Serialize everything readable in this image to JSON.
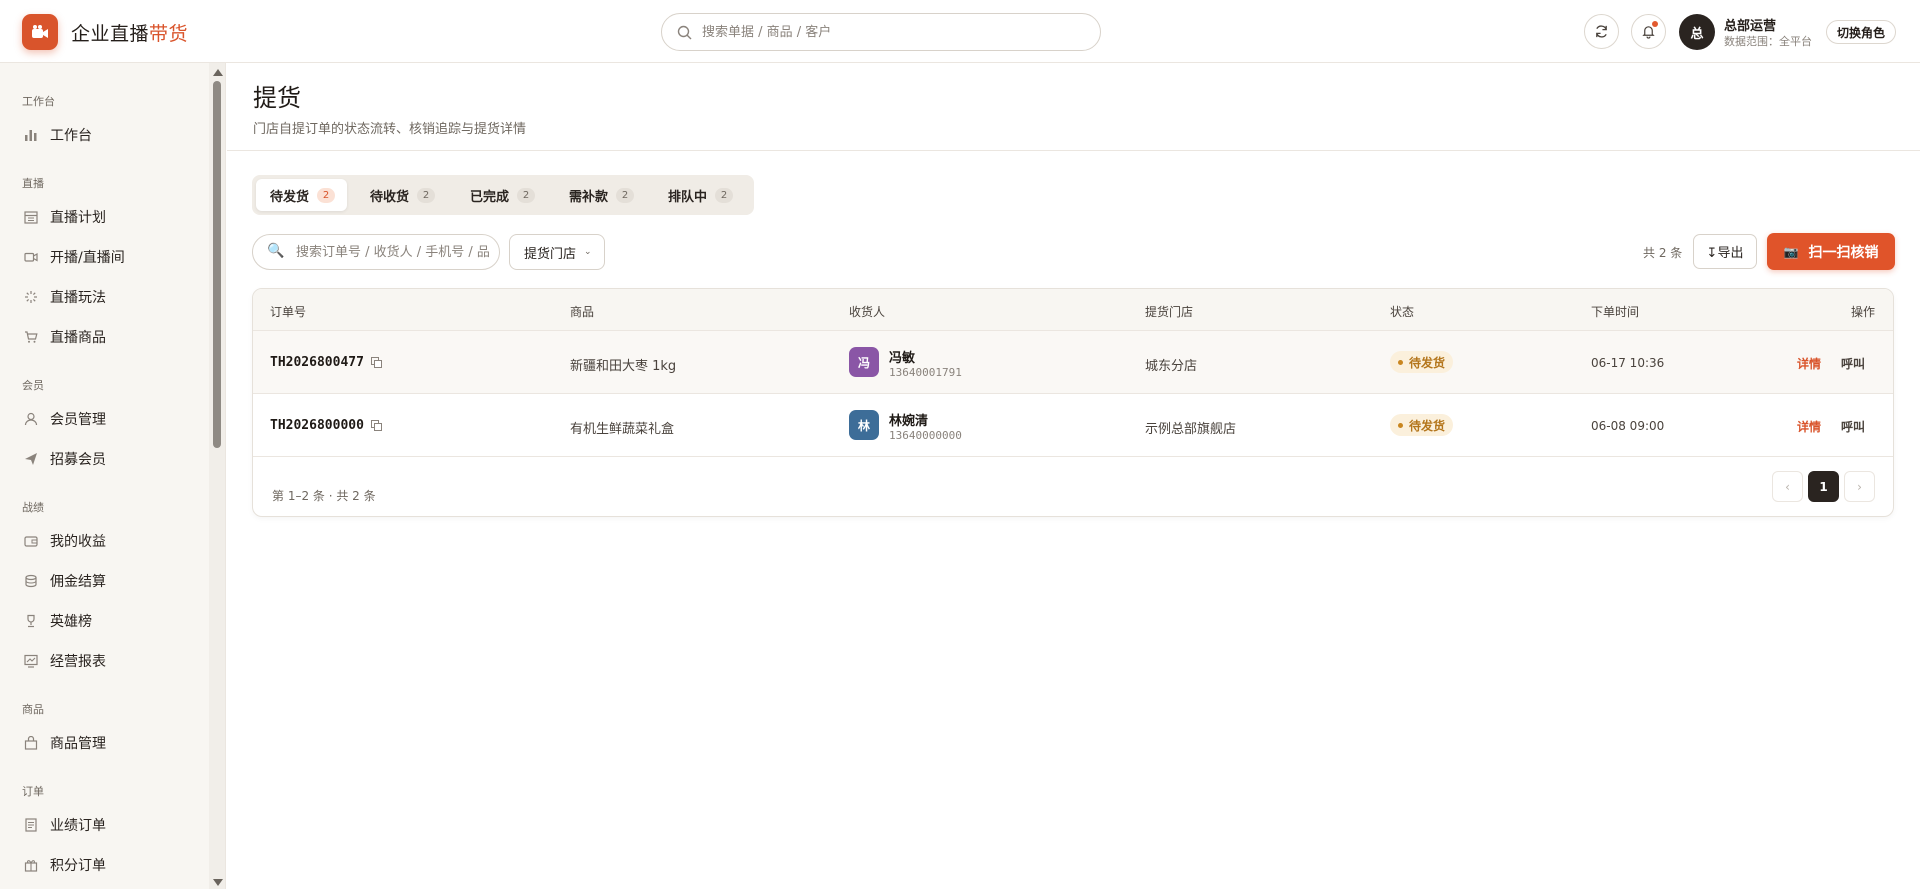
{
  "brand": {
    "name": "企业直播",
    "accent": "带货",
    "logo_icon": "camera-icon",
    "accent_color": "#d9542b"
  },
  "header": {
    "search_placeholder": "搜索单据 / 商品 / 客户",
    "refresh_icon": "refresh-icon",
    "bell_icon": "bell-icon",
    "avatar_text": "总",
    "user_name": "总部运营",
    "user_scope": "数据范围：全平台",
    "switch_role_label": "切换角色"
  },
  "sidebar": {
    "groups": [
      {
        "title": "工作台",
        "items": [
          {
            "label": "工作台",
            "icon": "bar-chart-icon"
          }
        ]
      },
      {
        "title": "直播",
        "items": [
          {
            "label": "直播计划",
            "icon": "calendar-icon"
          },
          {
            "label": "开播/直播间",
            "icon": "video-icon"
          },
          {
            "label": "直播玩法",
            "icon": "sparkle-icon"
          },
          {
            "label": "直播商品",
            "icon": "cart-icon"
          }
        ]
      },
      {
        "title": "会员",
        "items": [
          {
            "label": "会员管理",
            "icon": "user-icon"
          },
          {
            "label": "招募会员",
            "icon": "send-icon"
          }
        ]
      },
      {
        "title": "战绩",
        "items": [
          {
            "label": "我的收益",
            "icon": "wallet-icon"
          },
          {
            "label": "佣金结算",
            "icon": "coins-icon"
          },
          {
            "label": "英雄榜",
            "icon": "trophy-icon"
          },
          {
            "label": "经营报表",
            "icon": "report-icon"
          }
        ]
      },
      {
        "title": "商品",
        "items": [
          {
            "label": "商品管理",
            "icon": "bag-icon"
          }
        ]
      },
      {
        "title": "订单",
        "items": [
          {
            "label": "业绩订单",
            "icon": "receipt-icon"
          },
          {
            "label": "积分订单",
            "icon": "gift-icon"
          }
        ]
      }
    ]
  },
  "page": {
    "title": "提货",
    "subtitle": "门店自提订单的状态流转、核销追踪与提货详情"
  },
  "tabs": [
    {
      "label": "待发货",
      "count": "2",
      "active": true
    },
    {
      "label": "待收货",
      "count": "2"
    },
    {
      "label": "已完成",
      "count": "2"
    },
    {
      "label": "需补款",
      "count": "2"
    },
    {
      "label": "排队中",
      "count": "2"
    }
  ],
  "filters": {
    "search_placeholder": "搜索订单号 / 收货人 / 手机号 / 品",
    "store_select_label": "提货门店",
    "total_text": "共 2 条",
    "export_label": "↧导出",
    "scan_label": "扫一扫核销",
    "scan_icon": "camera-icon"
  },
  "table": {
    "columns": [
      "订单号",
      "商品",
      "收货人",
      "提货门店",
      "状态",
      "下单时间",
      "操作"
    ],
    "rows": [
      {
        "order_no": "TH2026800477",
        "product": "新疆和田大枣 1kg",
        "avatar_char": "冯",
        "avatar_color": "#8a56a6",
        "customer": "冯敏",
        "phone": "13640001791",
        "store": "城东分店",
        "status": "待发货",
        "time": "06-17 10:36",
        "detail": "详情",
        "call": "呼叫"
      },
      {
        "order_no": "TH2026800000",
        "product": "有机生鲜蔬菜礼盒",
        "avatar_char": "林",
        "avatar_color": "#3d6d98",
        "customer": "林婉清",
        "phone": "13640000000",
        "store": "示例总部旗舰店",
        "status": "待发货",
        "time": "06-08 09:00",
        "detail": "详情",
        "call": "呼叫"
      }
    ],
    "footer_text": "第 1–2 条 · 共 2 条",
    "pagination": {
      "prev": "‹",
      "current": "1",
      "next": "›"
    }
  }
}
